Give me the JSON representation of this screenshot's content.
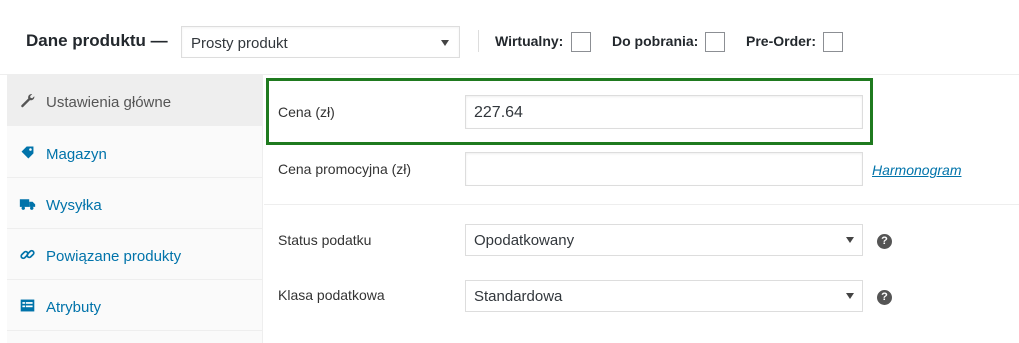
{
  "header": {
    "title": "Dane produktu —",
    "product_type": "Prosty produkt",
    "options": [
      {
        "label": "Wirtualny:",
        "checked": false
      },
      {
        "label": "Do pobrania:",
        "checked": false
      },
      {
        "label": "Pre-Order:",
        "checked": false
      }
    ]
  },
  "sidebar": {
    "items": [
      {
        "label": "Ustawienia główne",
        "icon": "wrench-icon",
        "active": true
      },
      {
        "label": "Magazyn",
        "icon": "tag-icon",
        "active": false
      },
      {
        "label": "Wysyłka",
        "icon": "truck-icon",
        "active": false
      },
      {
        "label": "Powiązane produkty",
        "icon": "link-icon",
        "active": false
      },
      {
        "label": "Atrybuty",
        "icon": "list-icon",
        "active": false
      }
    ]
  },
  "general": {
    "price_label": "Cena (zł)",
    "price_value": "227.64",
    "sale_price_label": "Cena promocyjna (zł)",
    "sale_price_value": "",
    "schedule_link": "Harmonogram",
    "tax_status_label": "Status podatku",
    "tax_status_value": "Opodatkowany",
    "tax_class_label": "Klasa podatkowa",
    "tax_class_value": "Standardowa",
    "help_glyph": "?"
  },
  "colors": {
    "link": "#0073aa",
    "highlight": "#1f7a1f"
  }
}
